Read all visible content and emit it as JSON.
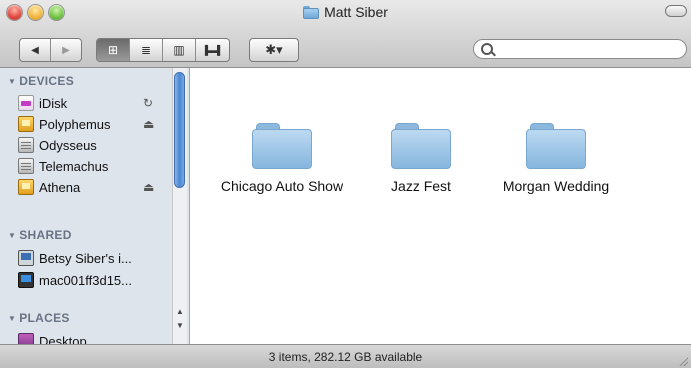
{
  "window": {
    "title": "Matt Siber"
  },
  "toolbar": {
    "back_icon": "back-arrow-icon",
    "forward_icon": "forward-arrow-icon",
    "views": [
      {
        "name": "icon-view",
        "glyph": "⊞",
        "active": true
      },
      {
        "name": "list-view",
        "glyph": "≣",
        "active": false
      },
      {
        "name": "column-view",
        "glyph": "▥",
        "active": false
      },
      {
        "name": "cover-flow-view",
        "glyph": "▐▬▌",
        "active": false
      }
    ],
    "action_glyph": "✱▾",
    "search": {
      "value": "",
      "placeholder": ""
    }
  },
  "sidebar": {
    "sections": [
      {
        "header": "DEVICES"
      },
      {
        "header": "SHARED"
      },
      {
        "header": "PLACES"
      }
    ],
    "devices": [
      {
        "label": "iDisk",
        "icon": "idisk-icon",
        "accessory": "sync-icon"
      },
      {
        "label": "Polyphemus",
        "icon": "external-drive-icon",
        "accessory": "eject-icon"
      },
      {
        "label": "Odysseus",
        "icon": "server-icon",
        "accessory": ""
      },
      {
        "label": "Telemachus",
        "icon": "server-icon",
        "accessory": ""
      },
      {
        "label": "Athena",
        "icon": "external-drive-icon",
        "accessory": "eject-icon"
      }
    ],
    "shared": [
      {
        "label": "Betsy Siber's i...",
        "icon": "imac-icon"
      },
      {
        "label": "mac001ff3d15...",
        "icon": "mac-icon"
      }
    ],
    "places": [
      {
        "label": "Desktop",
        "icon": "desktop-icon"
      }
    ]
  },
  "content": {
    "items": [
      {
        "label": "Chicago Auto Show",
        "icon": "folder-icon"
      },
      {
        "label": "Jazz Fest",
        "icon": "folder-icon"
      },
      {
        "label": "Morgan Wedding",
        "icon": "folder-icon"
      }
    ]
  },
  "status": {
    "text": "3 items, 282.12 GB available"
  }
}
